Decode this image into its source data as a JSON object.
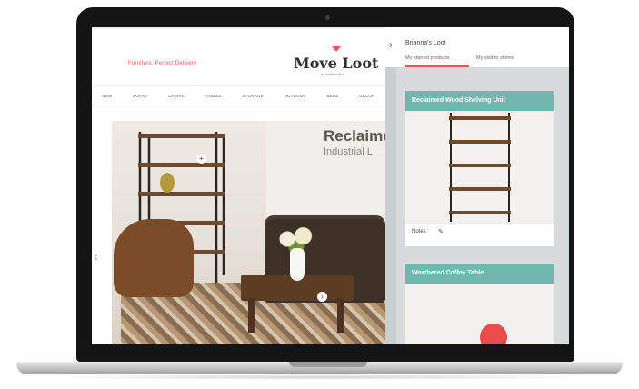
{
  "site": {
    "tagline": "Furniture. Perfect Delivery.",
    "logo": "Move Loot",
    "logo_sub": "as seen online",
    "nav": [
      "New",
      "Sofas",
      "Chairs",
      "Tables",
      "Storage",
      "Outdoor",
      "Beds",
      "Decor"
    ]
  },
  "hero": {
    "title": "Reclaime",
    "subtitle": "Industrial L"
  },
  "panel": {
    "title": "Brianna's Loot",
    "tabs": [
      "My starred products",
      "My visit to stores"
    ],
    "active_tab": 0,
    "cards": [
      {
        "title": "Reclaimed Wood Shelving Unit",
        "note": "Notes"
      },
      {
        "title": "Weathered Coffee Table",
        "note": ""
      }
    ]
  },
  "icons": {
    "panel_back": "chevron-left-icon",
    "carousel_prev": "chevron-left-icon",
    "note_edit": "pencil-icon",
    "hotspot": "plus-circle-icon"
  },
  "colors": {
    "accent": "#e35a57",
    "card_header": "#72b7ae",
    "panel_bg": "#d7dbdb",
    "fab": "#ea4b4b"
  }
}
